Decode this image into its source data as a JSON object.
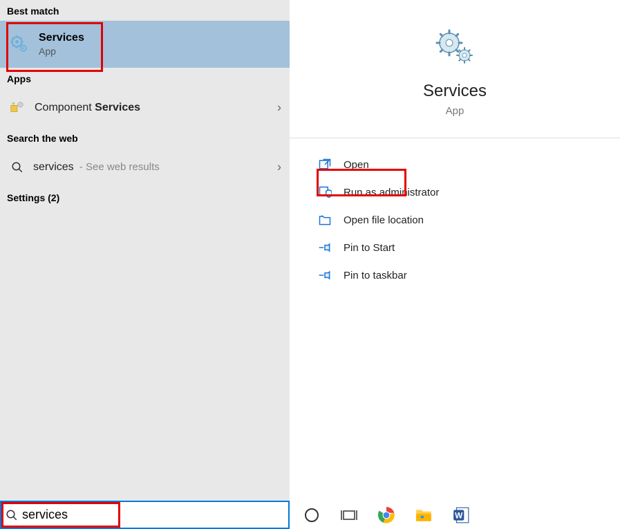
{
  "leftPane": {
    "bestMatchHeader": "Best match",
    "bestMatch": {
      "title": "Services",
      "subtitle": "App"
    },
    "appsHeader": "Apps",
    "appItem": {
      "prefix": "Component ",
      "bold": "Services"
    },
    "webHeader": "Search the web",
    "webItem": {
      "term": "services",
      "suffix": " - See web results"
    },
    "settingsHeader": "Settings (2)"
  },
  "rightPane": {
    "title": "Services",
    "subtitle": "App",
    "actions": {
      "open": "Open",
      "runAdmin": "Run as administrator",
      "openLocation": "Open file location",
      "pinStart": "Pin to Start",
      "pinTaskbar": "Pin to taskbar"
    }
  },
  "searchBox": {
    "value": "services"
  }
}
